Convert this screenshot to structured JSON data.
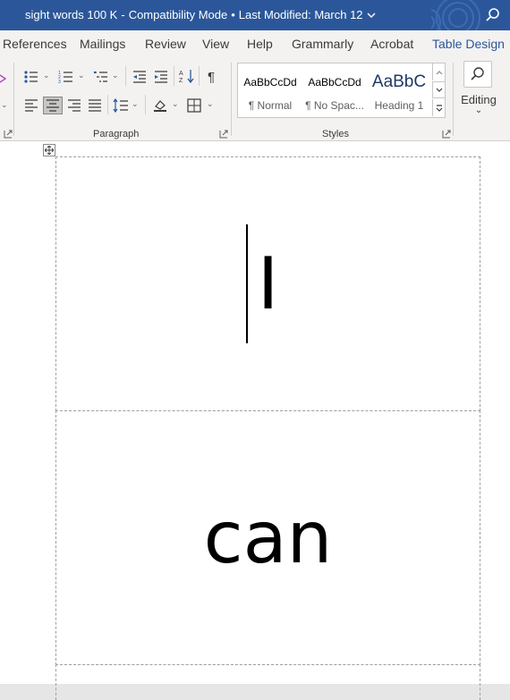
{
  "titlebar": {
    "document_name": "sight words 100 K",
    "separator": "-",
    "mode": "Compatibility Mode",
    "modified": "Last Modified: March 12",
    "bg_color": "#2b579a"
  },
  "tabs": {
    "items": [
      "References",
      "Mailings",
      "Review",
      "View",
      "Help",
      "Grammarly",
      "Acrobat",
      "Table Design"
    ],
    "active": "Table Design"
  },
  "ribbon": {
    "paragraph_label": "Paragraph",
    "styles_label": "Styles",
    "editing_label": "Editing",
    "styles": [
      {
        "sample": "AaBbCcDd",
        "name": "¶ Normal"
      },
      {
        "sample": "AaBbCcDd",
        "name": "¶ No Spac..."
      },
      {
        "sample": "AaBbC",
        "name": "Heading 1"
      }
    ]
  },
  "document": {
    "cells": [
      "I",
      "can"
    ]
  }
}
